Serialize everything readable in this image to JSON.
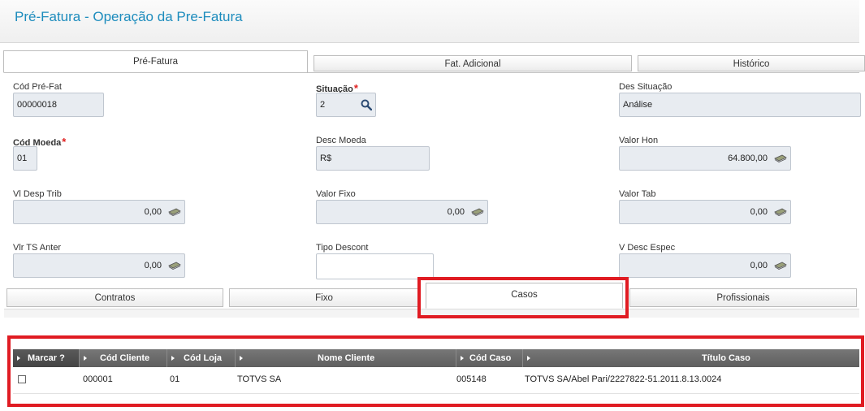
{
  "header": {
    "title": "Pré-Fatura - Operação da Pre-Fatura"
  },
  "top_tabs": [
    {
      "label": "Pré-Fatura"
    },
    {
      "label": "Fat. Adicional"
    },
    {
      "label": "Histórico"
    }
  ],
  "form": {
    "cod_pre_fat": {
      "label": "Cód Pré-Fat",
      "value": "00000018"
    },
    "situacao": {
      "label": "Situação",
      "value": "2"
    },
    "des_situacao": {
      "label": "Des Situação",
      "value": "Análise"
    },
    "cod_moeda": {
      "label": "Cód Moeda",
      "value": "01"
    },
    "desc_moeda": {
      "label": "Desc Moeda",
      "value": "R$"
    },
    "valor_hon": {
      "label": "Valor Hon",
      "value": "64.800,00"
    },
    "vl_desp_trib": {
      "label": "Vl Desp Trib",
      "value": "0,00"
    },
    "valor_fixo": {
      "label": "Valor Fixo",
      "value": "0,00"
    },
    "valor_tab": {
      "label": "Valor Tab",
      "value": "0,00"
    },
    "vlr_ts_anter": {
      "label": "Vlr TS Anter",
      "value": "0,00"
    },
    "tipo_descont": {
      "label": "Tipo Descont",
      "value": ""
    },
    "v_desc_espec": {
      "label": "V Desc Espec",
      "value": "0,00"
    },
    "required_mark": "*"
  },
  "sub_tabs": [
    {
      "label": "Contratos"
    },
    {
      "label": "Fixo"
    },
    {
      "label": "Casos"
    },
    {
      "label": "Profissionais"
    }
  ],
  "grid": {
    "columns": [
      "Marcar ?",
      "Cód Cliente",
      "Cód Loja",
      "Nome Cliente",
      "Cód Caso",
      "Título Caso"
    ],
    "rows": [
      {
        "marcar": false,
        "cod_cliente": "000001",
        "cod_loja": "01",
        "nome_cliente": "TOTVS SA",
        "cod_caso": "005148",
        "titulo_caso": "TOTVS SA/Abel Pari/2227822-51.2011.8.13.0024"
      }
    ]
  },
  "colors": {
    "title": "#1d8cbd",
    "highlight": "#e01b22",
    "field_bg": "#e8ecf1",
    "grid_header": "#666666"
  }
}
